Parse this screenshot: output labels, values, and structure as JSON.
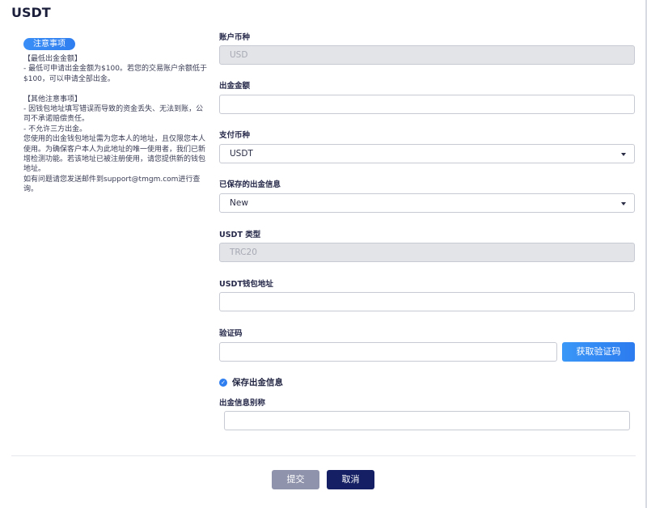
{
  "page": {
    "title": "USDT"
  },
  "notice": {
    "badge": "注意事项",
    "lines": [
      "【最低出金金额】",
      "- 最低可申请出金金额为$100。若您的交易账户余额低于",
      "$100，可以申请全部出金。",
      "",
      "【其他注意事项】",
      "- 因钱包地址填写错误而导致的资金丢失、无法到账，公",
      "司不承诺赔偿责任。",
      "- 不允许三方出金。",
      "您使用的出金钱包地址需为您本人的地址，且仅限您本人",
      "使用。为确保客户本人为此地址的唯一使用者，我们已新",
      "增检测功能。若该地址已被注册使用，请您提供新的钱包",
      "地址。",
      "如有问题请您发送邮件到support@tmgm.com进行查",
      "询。"
    ]
  },
  "form": {
    "account_currency": {
      "label": "账户币种",
      "value": "USD"
    },
    "withdraw_amount": {
      "label": "出金金额",
      "value": ""
    },
    "payment_currency": {
      "label": "支付币种",
      "value": "USDT"
    },
    "saved_info": {
      "label": "已保存的出金信息",
      "value": "New"
    },
    "usdt_type": {
      "label": "USDT 类型",
      "value": "TRC20"
    },
    "wallet_address": {
      "label": "USDT钱包地址",
      "value": ""
    },
    "verification": {
      "label": "验证码",
      "value": "",
      "button": "获取验证码"
    },
    "save_info": {
      "label": "保存出金信息",
      "checked": true
    },
    "alias": {
      "label": "出金信息别称",
      "value": ""
    }
  },
  "actions": {
    "submit": "提交",
    "cancel": "取消"
  },
  "colors": {
    "accent": "#2f7ef0",
    "primary_dark": "#152064",
    "submit_disabled": "#8f93ac"
  }
}
